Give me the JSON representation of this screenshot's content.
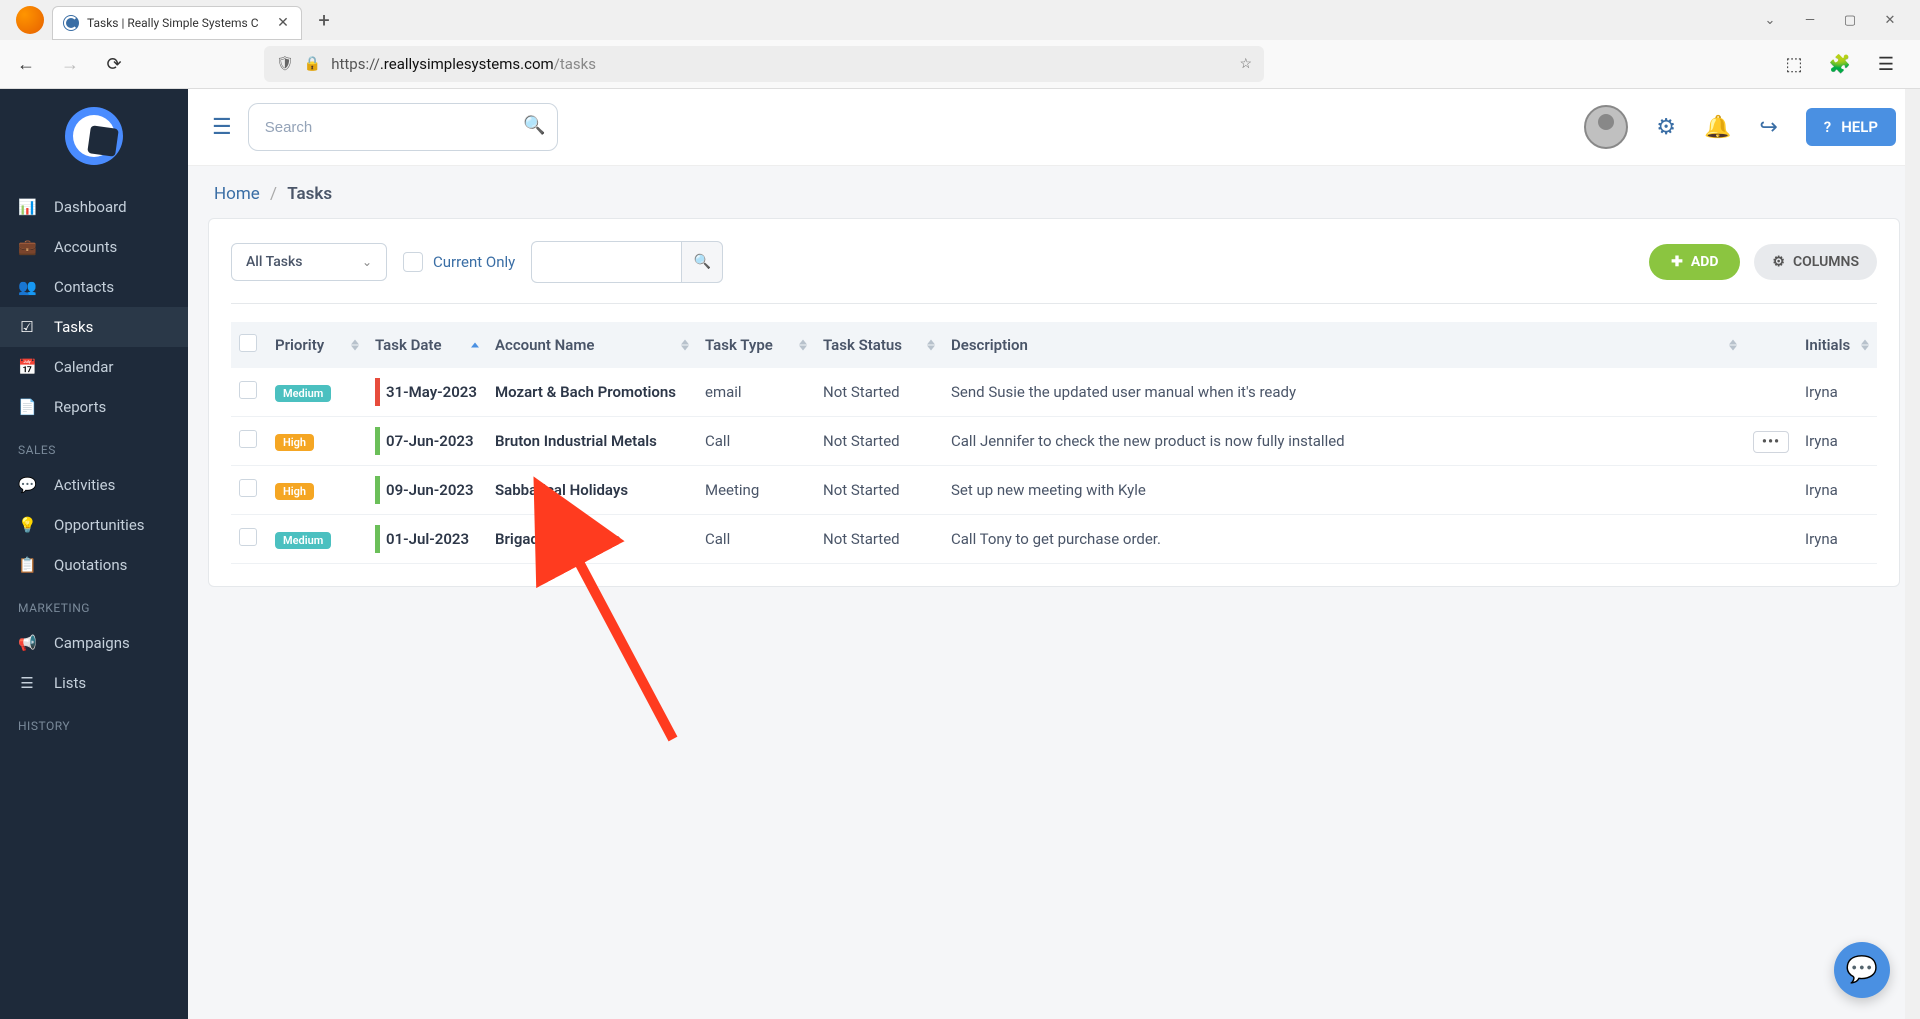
{
  "browser": {
    "tab_title": "Tasks | Really Simple Systems C",
    "url_prefix": "https://",
    "url_domain": ".reallysimplesystems.com",
    "url_path": "/tasks"
  },
  "topbar": {
    "search_placeholder": "Search",
    "help_label": "HELP"
  },
  "sidebar": {
    "items": [
      {
        "icon": "📊",
        "label": "Dashboard"
      },
      {
        "icon": "💼",
        "label": "Accounts"
      },
      {
        "icon": "👥",
        "label": "Contacts"
      },
      {
        "icon": "☑",
        "label": "Tasks",
        "active": true
      },
      {
        "icon": "📅",
        "label": "Calendar"
      },
      {
        "icon": "📄",
        "label": "Reports"
      }
    ],
    "section_sales": "SALES",
    "sales_items": [
      {
        "icon": "💬",
        "label": "Activities"
      },
      {
        "icon": "💡",
        "label": "Opportunities"
      },
      {
        "icon": "📋",
        "label": "Quotations"
      }
    ],
    "section_marketing": "MARKETING",
    "marketing_items": [
      {
        "icon": "📢",
        "label": "Campaigns"
      },
      {
        "icon": "☰",
        "label": "Lists"
      }
    ],
    "section_history": "HISTORY"
  },
  "breadcrumb": {
    "home": "Home",
    "current": "Tasks"
  },
  "filters": {
    "dropdown_label": "All Tasks",
    "current_only_label": "Current Only",
    "add_label": "ADD",
    "columns_label": "COLUMNS"
  },
  "table": {
    "headers": {
      "priority": "Priority",
      "task_date": "Task Date",
      "account_name": "Account Name",
      "task_type": "Task Type",
      "task_status": "Task Status",
      "description": "Description",
      "initials": "Initials"
    },
    "rows": [
      {
        "priority": "Medium",
        "priority_class": "medium",
        "bar": "red",
        "date": "31-May-2023",
        "account": "Mozart & Bach Promotions",
        "type": "email",
        "status": "Not Started",
        "desc": "Send Susie the updated user manual when it's ready",
        "initials": "Iryna",
        "more": false
      },
      {
        "priority": "High",
        "priority_class": "high",
        "bar": "green",
        "date": "07-Jun-2023",
        "account": "Bruton Industrial Metals",
        "type": "Call",
        "status": "Not Started",
        "desc": "Call Jennifer to check the new product is now fully installed",
        "initials": "Iryna",
        "more": true
      },
      {
        "priority": "High",
        "priority_class": "high",
        "bar": "green",
        "date": "09-Jun-2023",
        "account": "Sabbatical Holidays",
        "type": "Meeting",
        "status": "Not Started",
        "desc": "Set up new meeting with Kyle",
        "initials": "Iryna",
        "more": false
      },
      {
        "priority": "Medium",
        "priority_class": "medium",
        "bar": "green",
        "date": "01-Jul-2023",
        "account": "Brigadier Software",
        "type": "Call",
        "status": "Not Started",
        "desc": "Call Tony to get purchase order.",
        "initials": "Iryna",
        "more": false
      }
    ]
  }
}
